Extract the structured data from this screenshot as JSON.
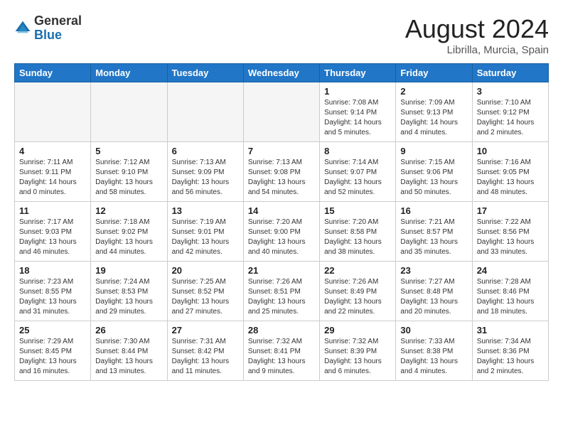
{
  "header": {
    "logo_general": "General",
    "logo_blue": "Blue",
    "month_title": "August 2024",
    "location": "Librilla, Murcia, Spain"
  },
  "weekdays": [
    "Sunday",
    "Monday",
    "Tuesday",
    "Wednesday",
    "Thursday",
    "Friday",
    "Saturday"
  ],
  "weeks": [
    [
      {
        "day": "",
        "info": ""
      },
      {
        "day": "",
        "info": ""
      },
      {
        "day": "",
        "info": ""
      },
      {
        "day": "",
        "info": ""
      },
      {
        "day": "1",
        "info": "Sunrise: 7:08 AM\nSunset: 9:14 PM\nDaylight: 14 hours\nand 5 minutes."
      },
      {
        "day": "2",
        "info": "Sunrise: 7:09 AM\nSunset: 9:13 PM\nDaylight: 14 hours\nand 4 minutes."
      },
      {
        "day": "3",
        "info": "Sunrise: 7:10 AM\nSunset: 9:12 PM\nDaylight: 14 hours\nand 2 minutes."
      }
    ],
    [
      {
        "day": "4",
        "info": "Sunrise: 7:11 AM\nSunset: 9:11 PM\nDaylight: 14 hours\nand 0 minutes."
      },
      {
        "day": "5",
        "info": "Sunrise: 7:12 AM\nSunset: 9:10 PM\nDaylight: 13 hours\nand 58 minutes."
      },
      {
        "day": "6",
        "info": "Sunrise: 7:13 AM\nSunset: 9:09 PM\nDaylight: 13 hours\nand 56 minutes."
      },
      {
        "day": "7",
        "info": "Sunrise: 7:13 AM\nSunset: 9:08 PM\nDaylight: 13 hours\nand 54 minutes."
      },
      {
        "day": "8",
        "info": "Sunrise: 7:14 AM\nSunset: 9:07 PM\nDaylight: 13 hours\nand 52 minutes."
      },
      {
        "day": "9",
        "info": "Sunrise: 7:15 AM\nSunset: 9:06 PM\nDaylight: 13 hours\nand 50 minutes."
      },
      {
        "day": "10",
        "info": "Sunrise: 7:16 AM\nSunset: 9:05 PM\nDaylight: 13 hours\nand 48 minutes."
      }
    ],
    [
      {
        "day": "11",
        "info": "Sunrise: 7:17 AM\nSunset: 9:03 PM\nDaylight: 13 hours\nand 46 minutes."
      },
      {
        "day": "12",
        "info": "Sunrise: 7:18 AM\nSunset: 9:02 PM\nDaylight: 13 hours\nand 44 minutes."
      },
      {
        "day": "13",
        "info": "Sunrise: 7:19 AM\nSunset: 9:01 PM\nDaylight: 13 hours\nand 42 minutes."
      },
      {
        "day": "14",
        "info": "Sunrise: 7:20 AM\nSunset: 9:00 PM\nDaylight: 13 hours\nand 40 minutes."
      },
      {
        "day": "15",
        "info": "Sunrise: 7:20 AM\nSunset: 8:58 PM\nDaylight: 13 hours\nand 38 minutes."
      },
      {
        "day": "16",
        "info": "Sunrise: 7:21 AM\nSunset: 8:57 PM\nDaylight: 13 hours\nand 35 minutes."
      },
      {
        "day": "17",
        "info": "Sunrise: 7:22 AM\nSunset: 8:56 PM\nDaylight: 13 hours\nand 33 minutes."
      }
    ],
    [
      {
        "day": "18",
        "info": "Sunrise: 7:23 AM\nSunset: 8:55 PM\nDaylight: 13 hours\nand 31 minutes."
      },
      {
        "day": "19",
        "info": "Sunrise: 7:24 AM\nSunset: 8:53 PM\nDaylight: 13 hours\nand 29 minutes."
      },
      {
        "day": "20",
        "info": "Sunrise: 7:25 AM\nSunset: 8:52 PM\nDaylight: 13 hours\nand 27 minutes."
      },
      {
        "day": "21",
        "info": "Sunrise: 7:26 AM\nSunset: 8:51 PM\nDaylight: 13 hours\nand 25 minutes."
      },
      {
        "day": "22",
        "info": "Sunrise: 7:26 AM\nSunset: 8:49 PM\nDaylight: 13 hours\nand 22 minutes."
      },
      {
        "day": "23",
        "info": "Sunrise: 7:27 AM\nSunset: 8:48 PM\nDaylight: 13 hours\nand 20 minutes."
      },
      {
        "day": "24",
        "info": "Sunrise: 7:28 AM\nSunset: 8:46 PM\nDaylight: 13 hours\nand 18 minutes."
      }
    ],
    [
      {
        "day": "25",
        "info": "Sunrise: 7:29 AM\nSunset: 8:45 PM\nDaylight: 13 hours\nand 16 minutes."
      },
      {
        "day": "26",
        "info": "Sunrise: 7:30 AM\nSunset: 8:44 PM\nDaylight: 13 hours\nand 13 minutes."
      },
      {
        "day": "27",
        "info": "Sunrise: 7:31 AM\nSunset: 8:42 PM\nDaylight: 13 hours\nand 11 minutes."
      },
      {
        "day": "28",
        "info": "Sunrise: 7:32 AM\nSunset: 8:41 PM\nDaylight: 13 hours\nand 9 minutes."
      },
      {
        "day": "29",
        "info": "Sunrise: 7:32 AM\nSunset: 8:39 PM\nDaylight: 13 hours\nand 6 minutes."
      },
      {
        "day": "30",
        "info": "Sunrise: 7:33 AM\nSunset: 8:38 PM\nDaylight: 13 hours\nand 4 minutes."
      },
      {
        "day": "31",
        "info": "Sunrise: 7:34 AM\nSunset: 8:36 PM\nDaylight: 13 hours\nand 2 minutes."
      }
    ]
  ]
}
